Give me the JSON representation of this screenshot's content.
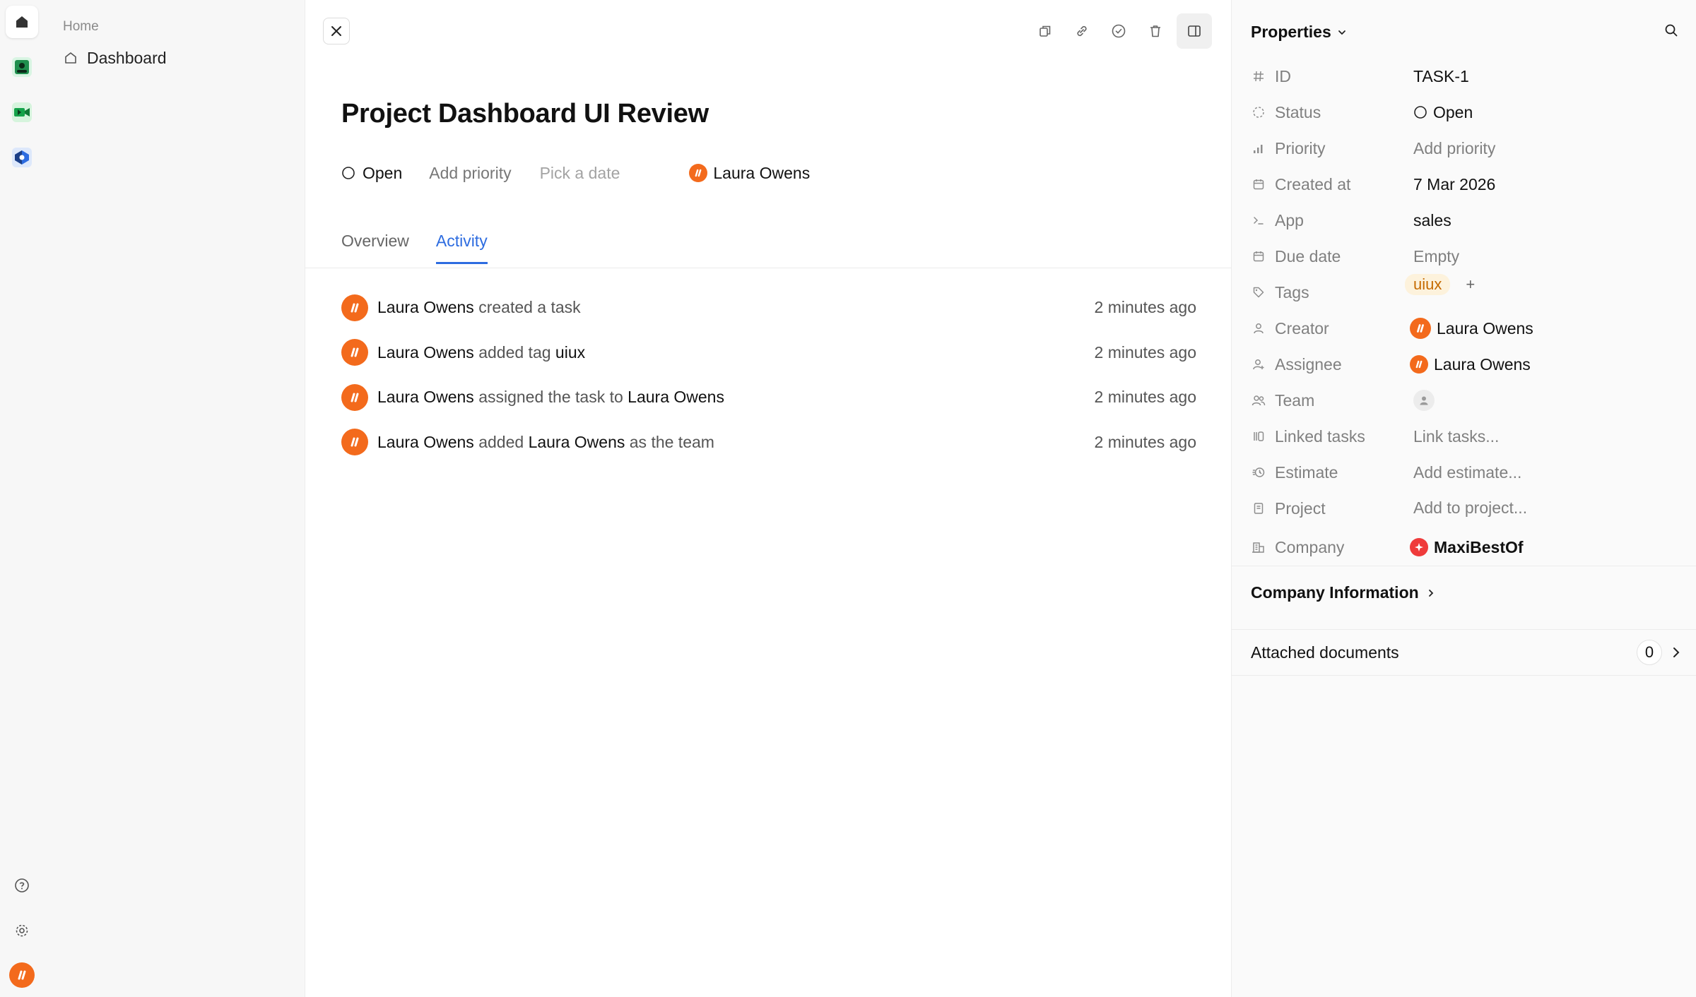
{
  "nav": {
    "section": "Home",
    "items": [
      {
        "label": "Dashboard",
        "icon": "home-icon"
      }
    ]
  },
  "rail": {
    "top_icons": [
      "home-icon",
      "app-icon-green",
      "app-icon-video",
      "app-icon-blue"
    ],
    "bottom_icons": [
      "help-icon",
      "gear-icon",
      "user-avatar-logo"
    ]
  },
  "task": {
    "title": "Project Dashboard UI Review",
    "status": "Open",
    "priority_placeholder": "Add priority",
    "date_placeholder": "Pick a date",
    "assignee": "Laura Owens"
  },
  "tabs": [
    {
      "label": "Overview",
      "active": false
    },
    {
      "label": "Activity",
      "active": true
    }
  ],
  "activity": [
    {
      "actor": "Laura Owens",
      "parts": [
        {
          "text": " created a task",
          "strong": false
        }
      ],
      "time": "2 minutes ago"
    },
    {
      "actor": "Laura Owens",
      "parts": [
        {
          "text": " added tag ",
          "strong": false
        },
        {
          "text": "uiux",
          "strong": true
        }
      ],
      "time": "2 minutes ago"
    },
    {
      "actor": "Laura Owens",
      "parts": [
        {
          "text": " assigned the task to ",
          "strong": false
        },
        {
          "text": "Laura Owens",
          "strong": true
        }
      ],
      "time": "2 minutes ago"
    },
    {
      "actor": "Laura Owens",
      "parts": [
        {
          "text": " added ",
          "strong": false
        },
        {
          "text": "Laura Owens",
          "strong": true
        },
        {
          "text": " as the team",
          "strong": false
        }
      ],
      "time": "2 minutes ago"
    }
  ],
  "panel": {
    "title": "Properties",
    "props": {
      "id": {
        "label": "ID",
        "value": "TASK-1"
      },
      "status": {
        "label": "Status",
        "value": "Open"
      },
      "priority": {
        "label": "Priority",
        "value": "Add priority"
      },
      "created_at": {
        "label": "Created at",
        "value": "7 Mar 2026"
      },
      "app": {
        "label": "App",
        "value": "sales"
      },
      "due_date": {
        "label": "Due date",
        "value": "Empty"
      },
      "tags": {
        "label": "Tags",
        "value": "uiux",
        "add": "+"
      },
      "creator": {
        "label": "Creator",
        "value": "Laura Owens"
      },
      "assignee": {
        "label": "Assignee",
        "value": "Laura Owens"
      },
      "team": {
        "label": "Team"
      },
      "linked_tasks": {
        "label": "Linked tasks",
        "value": "Link tasks..."
      },
      "estimate": {
        "label": "Estimate",
        "value": "Add estimate..."
      },
      "project": {
        "label": "Project",
        "value": "Add to project..."
      },
      "company": {
        "label": "Company",
        "value": "MaxiBestOf"
      }
    },
    "company_info": "Company Information",
    "attached_docs": {
      "label": "Attached documents",
      "count": "0"
    }
  },
  "colors": {
    "accent": "#2d6ce0",
    "brand_orange": "#f36a1c",
    "tag_bg": "#fdf2dc",
    "tag_text": "#c56a00",
    "company_red": "#ef3b3b"
  }
}
